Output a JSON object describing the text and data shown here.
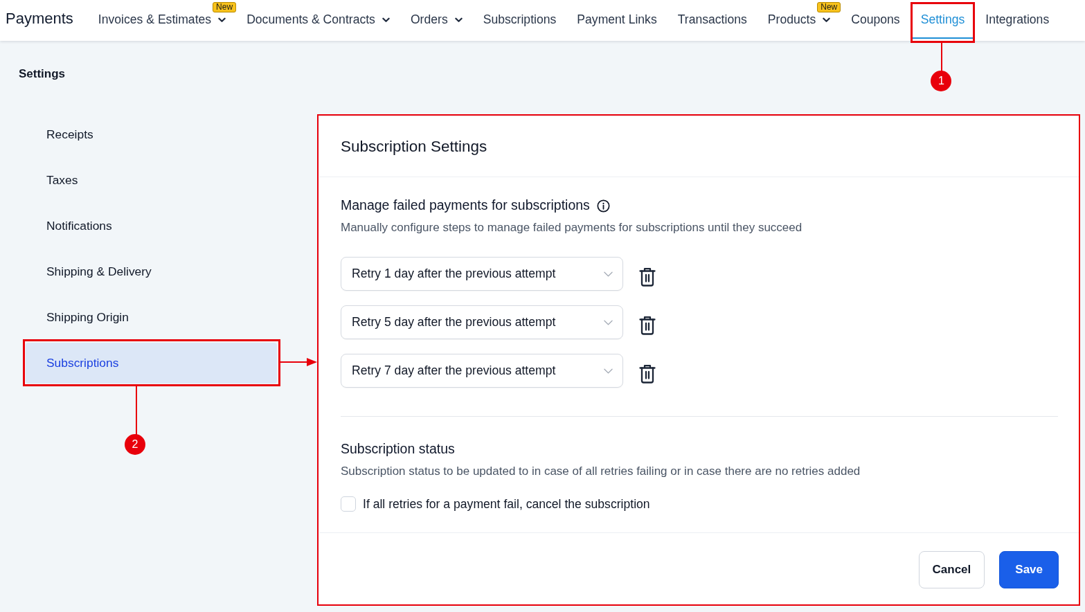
{
  "app": {
    "title": "Payments"
  },
  "nav": [
    {
      "label": "Invoices & Estimates",
      "badge": "New",
      "has_menu": true,
      "selected": false
    },
    {
      "label": "Documents & Contracts",
      "has_menu": true,
      "selected": false
    },
    {
      "label": "Orders",
      "has_menu": true,
      "selected": false
    },
    {
      "label": "Subscriptions",
      "has_menu": false,
      "selected": false
    },
    {
      "label": "Payment Links",
      "has_menu": false,
      "selected": false
    },
    {
      "label": "Transactions",
      "has_menu": false,
      "selected": false
    },
    {
      "label": "Products",
      "badge": "New",
      "has_menu": true,
      "selected": false
    },
    {
      "label": "Coupons",
      "has_menu": false,
      "selected": false
    },
    {
      "label": "Settings",
      "has_menu": false,
      "selected": true,
      "callout": {
        "number": "1",
        "arrow": false
      }
    },
    {
      "label": "Integrations",
      "has_menu": false,
      "selected": false
    }
  ],
  "sidebar": {
    "title": "Settings",
    "items": [
      {
        "label": "Receipts",
        "selected": false
      },
      {
        "label": "Taxes",
        "selected": false
      },
      {
        "label": "Notifications",
        "selected": false
      },
      {
        "label": "Shipping & Delivery",
        "selected": false
      },
      {
        "label": "Shipping Origin",
        "selected": false
      },
      {
        "label": "Subscriptions",
        "selected": true,
        "callout": {
          "number": "2",
          "arrow": true
        }
      }
    ]
  },
  "panel": {
    "title": "Subscription Settings",
    "highlighted": true,
    "retry_section": {
      "title": "Manage failed payments for subscriptions",
      "description": "Manually configure steps to manage failed payments for subscriptions until they succeed",
      "steps": [
        {
          "value": "Retry 1 day after the previous attempt"
        },
        {
          "value": "Retry 5 day after the previous attempt"
        },
        {
          "value": "Retry 7 day after the previous attempt"
        }
      ]
    },
    "status_section": {
      "title": "Subscription status",
      "description": "Subscription status to be updated to in case of all retries failing or in case there are no retries added",
      "option": {
        "label": "If all retries for a payment fail, cancel the subscription",
        "checked": false
      }
    },
    "buttons": [
      {
        "label": "Cancel",
        "kind": "secondary"
      },
      {
        "label": "Save",
        "kind": "primary"
      }
    ]
  }
}
